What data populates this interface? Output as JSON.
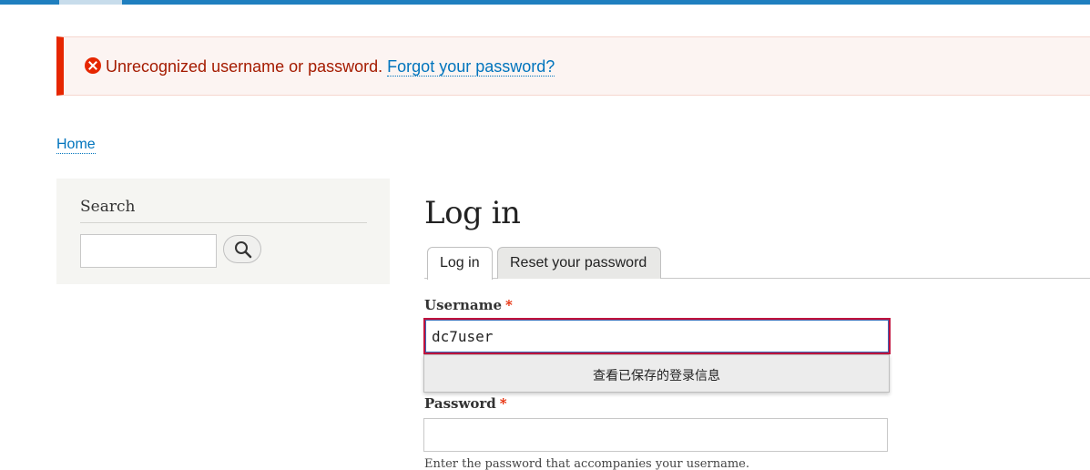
{
  "alert": {
    "message": "Unrecognized username or password.",
    "link": "Forgot your password?",
    "icon": "error-icon",
    "color": "#e62600"
  },
  "breadcrumb": {
    "home": "Home"
  },
  "sidebar": {
    "title": "Search",
    "search_value": "",
    "search_icon": "search-icon"
  },
  "main": {
    "title": "Log in",
    "tabs": [
      {
        "label": "Log in",
        "active": true
      },
      {
        "label": "Reset your password",
        "active": false
      }
    ],
    "username": {
      "label": "Username",
      "required_mark": "*",
      "value": "dc7user"
    },
    "autofill": {
      "label": "查看已保存的登录信息"
    },
    "password": {
      "label": "Password",
      "required_mark": "*",
      "value": "",
      "help": "Enter the password that accompanies your username."
    }
  },
  "colors": {
    "accent": "#0074bd",
    "topbar": "#1f7fbf",
    "error_text": "#a51b00",
    "error_border": "#c1133d"
  }
}
